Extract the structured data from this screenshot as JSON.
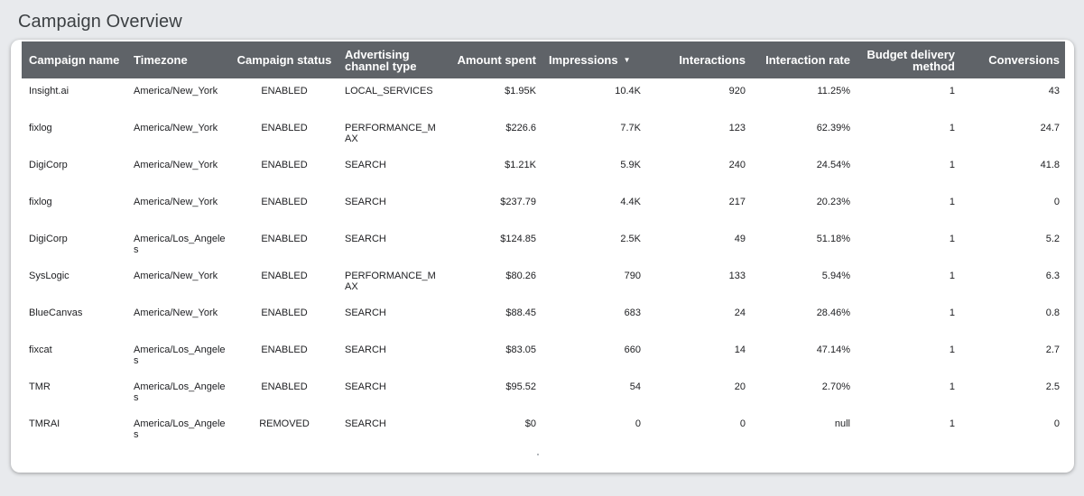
{
  "page": {
    "title": "Campaign Overview"
  },
  "colors": {
    "header_bg": "#5f6368",
    "page_bg": "#e8eaed",
    "card_bg": "#ffffff"
  },
  "table": {
    "columns": [
      {
        "key": "campaign_name",
        "label": "Campaign name"
      },
      {
        "key": "timezone",
        "label": "Timezone"
      },
      {
        "key": "campaign_status",
        "label": "Campaign status"
      },
      {
        "key": "advertising_channel_type",
        "label": "Advertising channel type"
      },
      {
        "key": "amount_spent",
        "label": "Amount spent"
      },
      {
        "key": "impressions",
        "label": "Impressions",
        "sort_icon": "sort-descending-icon",
        "sort_glyph": "▼"
      },
      {
        "key": "interactions",
        "label": "Interactions"
      },
      {
        "key": "interaction_rate",
        "label": "Interaction rate"
      },
      {
        "key": "budget_delivery_method",
        "label": "Budget delivery method"
      },
      {
        "key": "conversions",
        "label": "Conversions"
      }
    ],
    "rows": [
      {
        "campaign_name": "Insight.ai",
        "timezone": "America/New_York",
        "campaign_status": "ENABLED",
        "advertising_channel_type": "LOCAL_SERVICES",
        "amount_spent": "$1.95K",
        "impressions": "10.4K",
        "interactions": "920",
        "interaction_rate": "11.25%",
        "budget_delivery_method": "1",
        "conversions": "43"
      },
      {
        "campaign_name": "fixlog",
        "timezone": "America/New_York",
        "campaign_status": "ENABLED",
        "advertising_channel_type": "PERFORMANCE_MAX",
        "amount_spent": "$226.6",
        "impressions": "7.7K",
        "interactions": "123",
        "interaction_rate": "62.39%",
        "budget_delivery_method": "1",
        "conversions": "24.7"
      },
      {
        "campaign_name": "DigiCorp",
        "timezone": "America/New_York",
        "campaign_status": "ENABLED",
        "advertising_channel_type": "SEARCH",
        "amount_spent": "$1.21K",
        "impressions": "5.9K",
        "interactions": "240",
        "interaction_rate": "24.54%",
        "budget_delivery_method": "1",
        "conversions": "41.8"
      },
      {
        "campaign_name": "fixlog",
        "timezone": "America/New_York",
        "campaign_status": "ENABLED",
        "advertising_channel_type": "SEARCH",
        "amount_spent": "$237.79",
        "impressions": "4.4K",
        "interactions": "217",
        "interaction_rate": "20.23%",
        "budget_delivery_method": "1",
        "conversions": "0"
      },
      {
        "campaign_name": "DigiCorp",
        "timezone": "America/Los_Angeles",
        "campaign_status": "ENABLED",
        "advertising_channel_type": "SEARCH",
        "amount_spent": "$124.85",
        "impressions": "2.5K",
        "interactions": "49",
        "interaction_rate": "51.18%",
        "budget_delivery_method": "1",
        "conversions": "5.2"
      },
      {
        "campaign_name": "SysLogic",
        "timezone": "America/New_York",
        "campaign_status": "ENABLED",
        "advertising_channel_type": "PERFORMANCE_MAX",
        "amount_spent": "$80.26",
        "impressions": "790",
        "interactions": "133",
        "interaction_rate": "5.94%",
        "budget_delivery_method": "1",
        "conversions": "6.3"
      },
      {
        "campaign_name": "BlueCanvas",
        "timezone": "America/New_York",
        "campaign_status": "ENABLED",
        "advertising_channel_type": "SEARCH",
        "amount_spent": "$88.45",
        "impressions": "683",
        "interactions": "24",
        "interaction_rate": "28.46%",
        "budget_delivery_method": "1",
        "conversions": "0.8"
      },
      {
        "campaign_name": "fixcat",
        "timezone": "America/Los_Angeles",
        "campaign_status": "ENABLED",
        "advertising_channel_type": "SEARCH",
        "amount_spent": "$83.05",
        "impressions": "660",
        "interactions": "14",
        "interaction_rate": "47.14%",
        "budget_delivery_method": "1",
        "conversions": "2.7"
      },
      {
        "campaign_name": "TMR",
        "timezone": "America/Los_Angeles",
        "campaign_status": "ENABLED",
        "advertising_channel_type": "SEARCH",
        "amount_spent": "$95.52",
        "impressions": "54",
        "interactions": "20",
        "interaction_rate": "2.70%",
        "budget_delivery_method": "1",
        "conversions": "2.5"
      },
      {
        "campaign_name": "TMRAI",
        "timezone": "America/Los_Angeles",
        "campaign_status": "REMOVED",
        "advertising_channel_type": "SEARCH",
        "amount_spent": "$0",
        "impressions": "0",
        "interactions": "0",
        "interaction_rate": "null",
        "budget_delivery_method": "1",
        "conversions": "0"
      }
    ]
  }
}
